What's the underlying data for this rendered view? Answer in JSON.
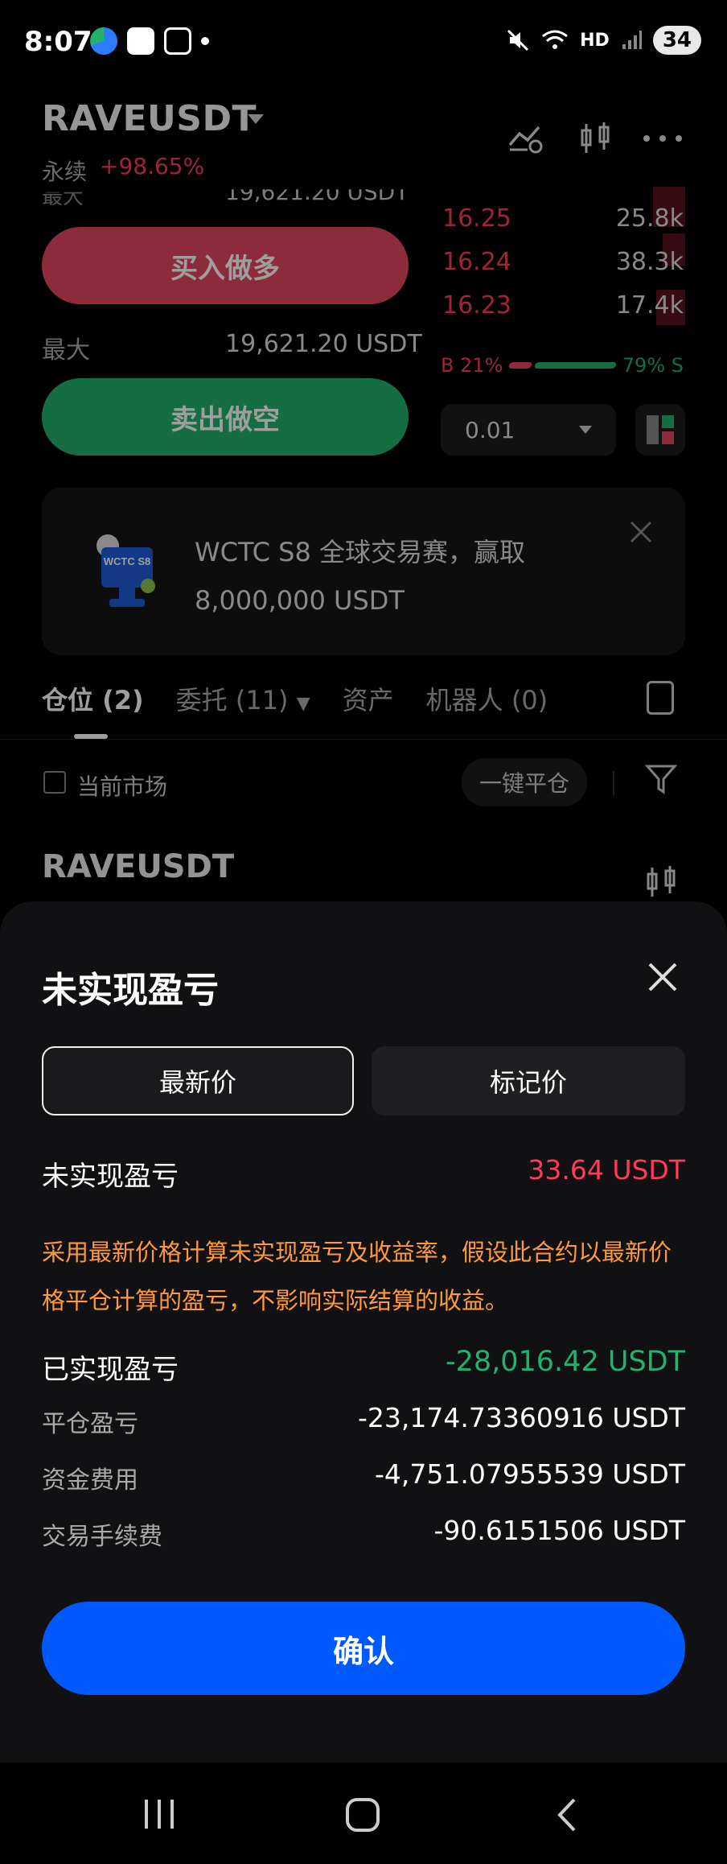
{
  "status": {
    "time": "8:07",
    "network": "HD",
    "battery": "34"
  },
  "header": {
    "pair": "RAVEUSDT",
    "perp_label": "永续",
    "change": "+98.65%"
  },
  "trade": {
    "max_label_cut": "最大",
    "max_value_cut": "19,621.20 USDT",
    "buy_label": "买入做多",
    "max_label": "最大",
    "max_value": "19,621.20 USDT",
    "sell_label": "卖出做空"
  },
  "orderbook": {
    "asks": [
      {
        "price": "16.25",
        "qty": "25.8k"
      },
      {
        "price": "16.24",
        "qty": "38.3k"
      },
      {
        "price": "16.23",
        "qty": "17.4k"
      }
    ],
    "buy_ratio": "B 21%",
    "sell_ratio": "79% S",
    "buy_fraction": 0.21,
    "depth": "0.01"
  },
  "banner": {
    "logo_text": "WCTC S8",
    "line1": "WCTC S8 全球交易赛，赢取",
    "line2": "8,000,000 USDT"
  },
  "tabs": [
    {
      "label": "仓位 (2)"
    },
    {
      "label": "委托 (11)"
    },
    {
      "label": "资产"
    },
    {
      "label": "机器人 (0)"
    }
  ],
  "filters": {
    "current_market": "当前市场",
    "close_all": "一键平仓"
  },
  "position": {
    "symbol": "RAVEUSDT"
  },
  "sheet": {
    "title": "未实现盈亏",
    "seg_latest": "最新价",
    "seg_mark": "标记价",
    "unrealized_label": "未实现盈亏",
    "unrealized_value": "33.64 USDT",
    "explain": "采用最新价格计算未实现盈亏及收益率，假设此合约以最新价格平仓计算的盈亏，不影响实际结算的收益。",
    "realized_label": "已实现盈亏",
    "realized_value": "-28,016.42 USDT",
    "close_pnl_label": "平仓盈亏",
    "close_pnl_value": "-23,174.73360916 USDT",
    "funding_label": "资金费用",
    "funding_value": "-4,751.07955539 USDT",
    "fee_label": "交易手续费",
    "fee_value": "-90.6151506 USDT",
    "confirm": "确认"
  },
  "colors": {
    "accent_blue": "#0059ff",
    "red": "#ff3b5c",
    "green": "#23b26d",
    "orange": "#ff9a3c"
  }
}
